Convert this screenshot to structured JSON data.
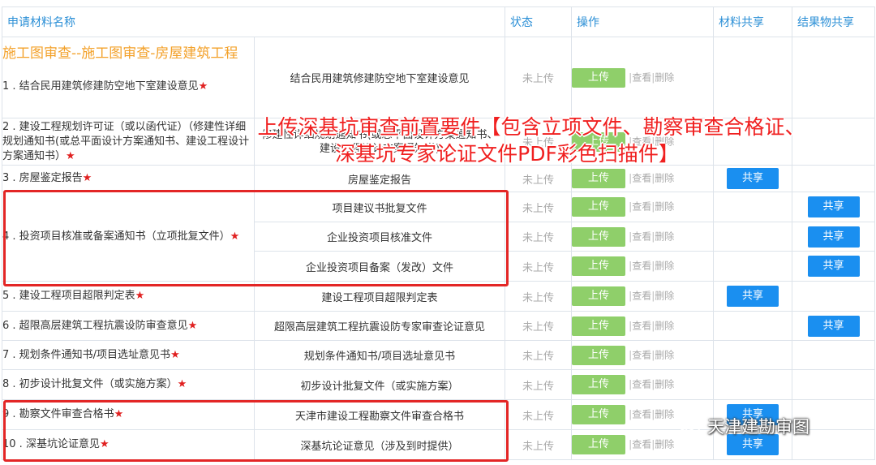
{
  "headers": {
    "name": "申请材料名称",
    "status": "状态",
    "ops": "操作",
    "share": "材料共享",
    "result_share": "结果物共享"
  },
  "group_title": "施工图审查--施工图审查-房屋建筑工程",
  "labels": {
    "upload": "上传",
    "view": "查看",
    "delete": "删除",
    "share": "共享",
    "status_not_uploaded": "未上传",
    "sep": "|",
    "star": "★"
  },
  "rows": [
    {
      "name": "1 . 结合民用建筑修建防空地下室建设意见",
      "material": "结合民用建筑修建防空地下室建设意见"
    },
    {
      "name": "2 . 建设工程规划许可证（或以函代证）（修建性详细规划通知书(或总平面设计方案通知书、建设工程设计方案通知书）",
      "material": "修建性详细规划通知书(或总平面设计方案通知书、建设工程设计方案通知书)"
    },
    {
      "name": "3 . 房屋鉴定报告",
      "material": "房屋鉴定报告"
    },
    {
      "name": "4 . 投资项目核准或备案通知书（立项批复文件）",
      "materials": [
        "项目建议书批复文件",
        "企业投资项目核准文件",
        "企业投资项目备案（发改）文件"
      ]
    },
    {
      "name": "5 . 建设工程项目超限判定表",
      "material": "建设工程项目超限判定表"
    },
    {
      "name": "6 . 超限高层建筑工程抗震设防审查意见",
      "material": "超限高层建筑工程抗震设防专家审查论证意见"
    },
    {
      "name": "7 . 规划条件通知书/项目选址意见书",
      "material": "规划条件通知书/项目选址意见书"
    },
    {
      "name": "8 . 初步设计批复文件（或实施方案）",
      "material": "初步设计批复文件（或实施方案）"
    },
    {
      "name": "9 . 勘察文件审查合格书",
      "material": "天津市建设工程勘察文件审查合格书"
    },
    {
      "name": "10 . 深基坑论证意见",
      "material": "深基坑论证意见（涉及到时提供）"
    }
  ],
  "banner": {
    "line1": "上传深基坑审查前置要件【包含立项文件、勘察审查合格证、",
    "line2": "深基坑专家论证文件PDF彩色扫描件】"
  },
  "watermark": "天津建勘审图",
  "colors": {
    "header_text": "#2b8fd6",
    "group_title": "#f3a12a",
    "upload_button": "#8fcf6a",
    "share_button": "#1a8ff0",
    "highlight": "#e32626"
  }
}
